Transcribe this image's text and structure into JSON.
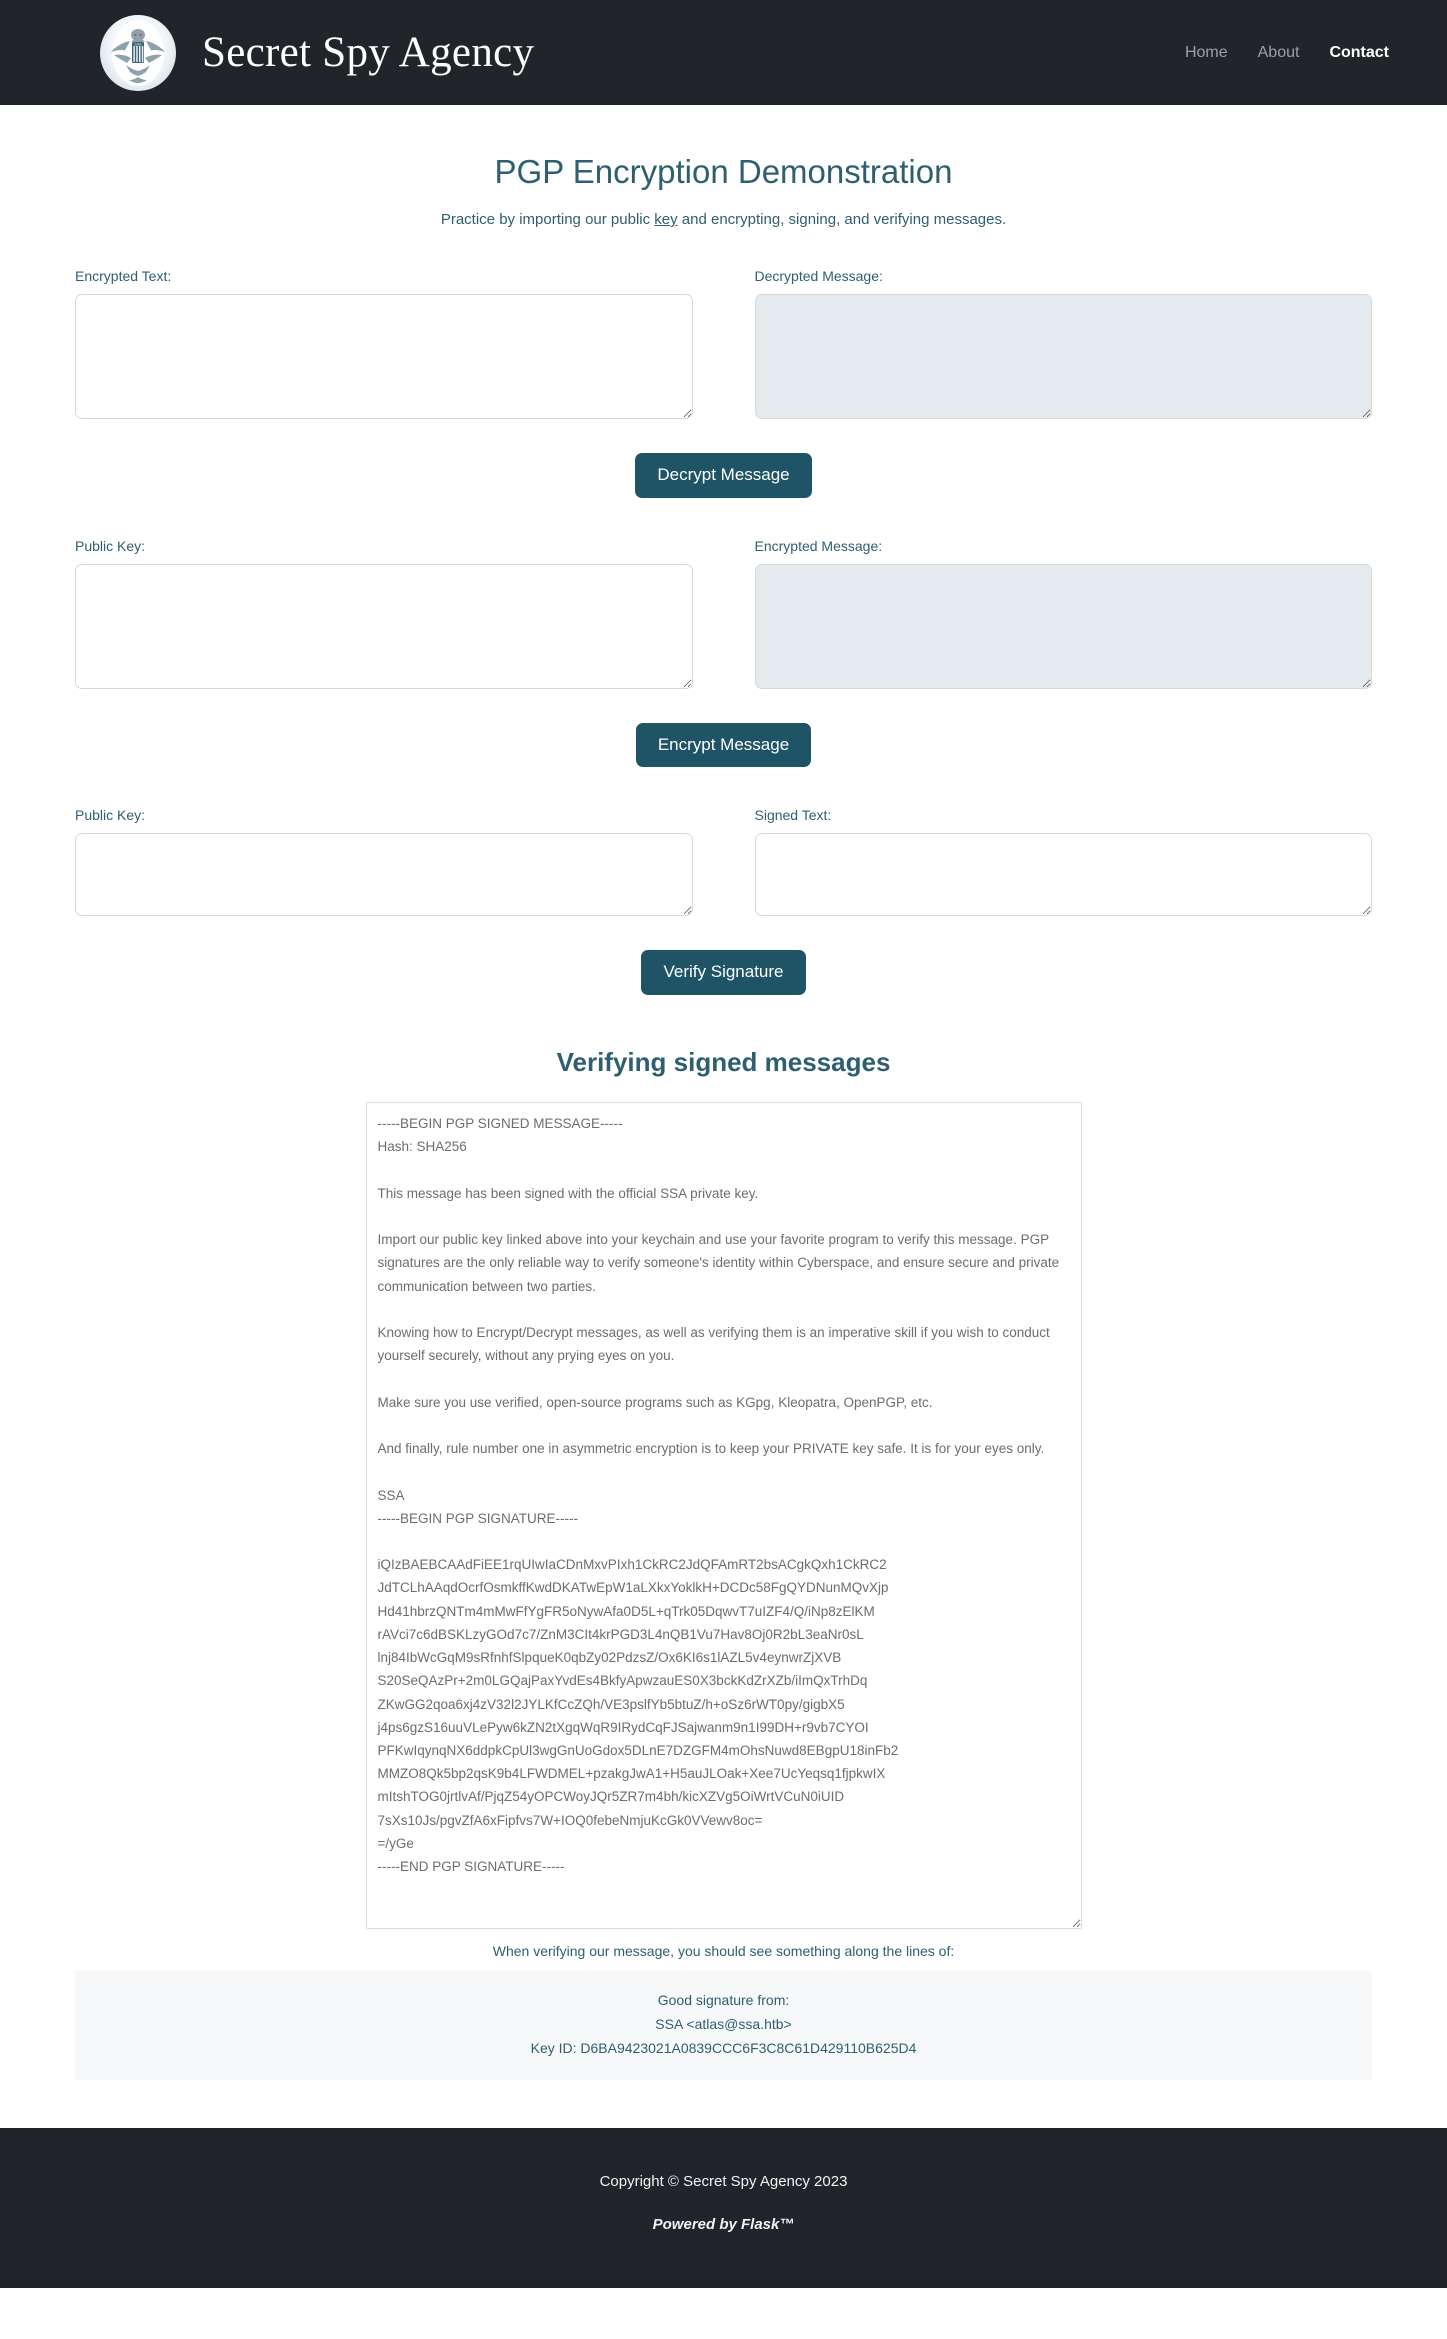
{
  "header": {
    "brand_title": "Secret Spy Agency",
    "logo_icon": "agency-seal-eagle-icon",
    "nav": [
      {
        "label": "Home",
        "active": false
      },
      {
        "label": "About",
        "active": false
      },
      {
        "label": "Contact",
        "active": true
      }
    ]
  },
  "main": {
    "title": "PGP Encryption Demonstration",
    "subtitle_before": "Practice by importing our public ",
    "subtitle_link": "key",
    "subtitle_after": " and encrypting, signing, and verifying messages.",
    "sections": [
      {
        "left_label": "Encrypted Text:",
        "left_value": "",
        "left_readonly": false,
        "right_label": "Decrypted Message:",
        "right_value": "",
        "right_readonly": true,
        "button_label": "Decrypt Message"
      },
      {
        "left_label": "Public Key:",
        "left_value": "",
        "left_readonly": false,
        "right_label": "Encrypted Message:",
        "right_value": "",
        "right_readonly": true,
        "button_label": "Encrypt Message"
      },
      {
        "left_label": "Public Key:",
        "left_value": "",
        "left_readonly": false,
        "right_label": "Signed Text:",
        "right_value": "",
        "right_readonly": false,
        "button_label": "Verify Signature"
      }
    ],
    "verify_heading": "Verifying signed messages",
    "signed_message": "-----BEGIN PGP SIGNED MESSAGE-----\nHash: SHA256\n\nThis message has been signed with the official SSA private key.\n\nImport our public key linked above into your keychain and use your favorite program to verify this message. PGP signatures are the only reliable way to verify someone's identity within Cyberspace, and ensure secure and private communication between two parties.\n\nKnowing how to Encrypt/Decrypt messages, as well as verifying them is an imperative skill if you wish to conduct yourself securely, without any prying eyes on you.\n\nMake sure you use verified, open-source programs such as KGpg, Kleopatra, OpenPGP, etc.\n\nAnd finally, rule number one in asymmetric encryption is to keep your PRIVATE key safe. It is for your eyes only.\n\nSSA\n-----BEGIN PGP SIGNATURE-----\n\niQIzBAEBCAAdFiEE1rqUIwIaCDnMxvPIxh1CkRC2JdQFAmRT2bsACgkQxh1CkRC2\nJdTCLhAAqdOcrfOsmkffKwdDKATwEpW1aLXkxYoklkH+DCDc58FgQYDNunMQvXjp\nHd41hbrzQNTm4mMwFfYgFR5oNywAfa0D5L+qTrk05DqwvT7uIZF4/Q/iNp8zElKM\nrAVci7c6dBSKLzyGOd7c7/ZnM3CIt4krPGD3L4nQB1Vu7Hav8Oj0R2bL3eaNr0sL\nlnj84IbWcGqM9sRfnhfSlpqueK0qbZy02PdzsZ/Ox6KI6s1lAZL5v4eynwrZjXVB\nS20SeQAzPr+2m0LGQajPaxYvdEs4BkfyApwzauES0X3bckKdZrXZb/iImQxTrhDq\nZKwGG2qoa6xj4zV32l2JYLKfCcZQh/VE3pslfYb5btuZ/h+oSz6rWT0py/gigbX5\nj4ps6gzS16uuVLePyw6kZN2tXgqWqR9IRydCqFJSajwanm9n1I99DH+r9vb7CYOI\nPFKwIqynqNX6ddpkCpUl3wgGnUoGdox5DLnE7DZGFM4mOhsNuwd8EBgpU18inFb2\nMMZO8Qk5bp2qsK9b4LFWDMEL+pzakgJwA1+H5auJLOak+Xee7UcYeqsq1fjpkwIX\nmItshTOG0jrtlvAf/PjqZ54yOPCWoyJQr5ZR7m4bh/kicXZVg5OiWrtVCuN0iUID\n7sXs10Js/pgvZfA6xFipfvs7W+IOQ0febeNmjuKcGk0VVewv8oc=\n=/yGe\n-----END PGP SIGNATURE-----",
    "verify_caption": "When verifying our message, you should see something along the lines of:",
    "result": {
      "line1": "Good signature from:",
      "line2": "SSA <atlas@ssa.htb>",
      "line3": "Key ID: D6BA9423021A0839CCC6F3C8C61D429110B625D4"
    }
  },
  "footer": {
    "copyright": "Copyright © Secret Spy Agency 2023",
    "powered_by": "Powered by Flask™"
  },
  "colors": {
    "header_bg": "#212529",
    "accent_teal": "#2e5f70",
    "button_bg": "#1f5466",
    "readonly_bg": "#e5eaee",
    "result_bg": "#f6f8f9"
  }
}
